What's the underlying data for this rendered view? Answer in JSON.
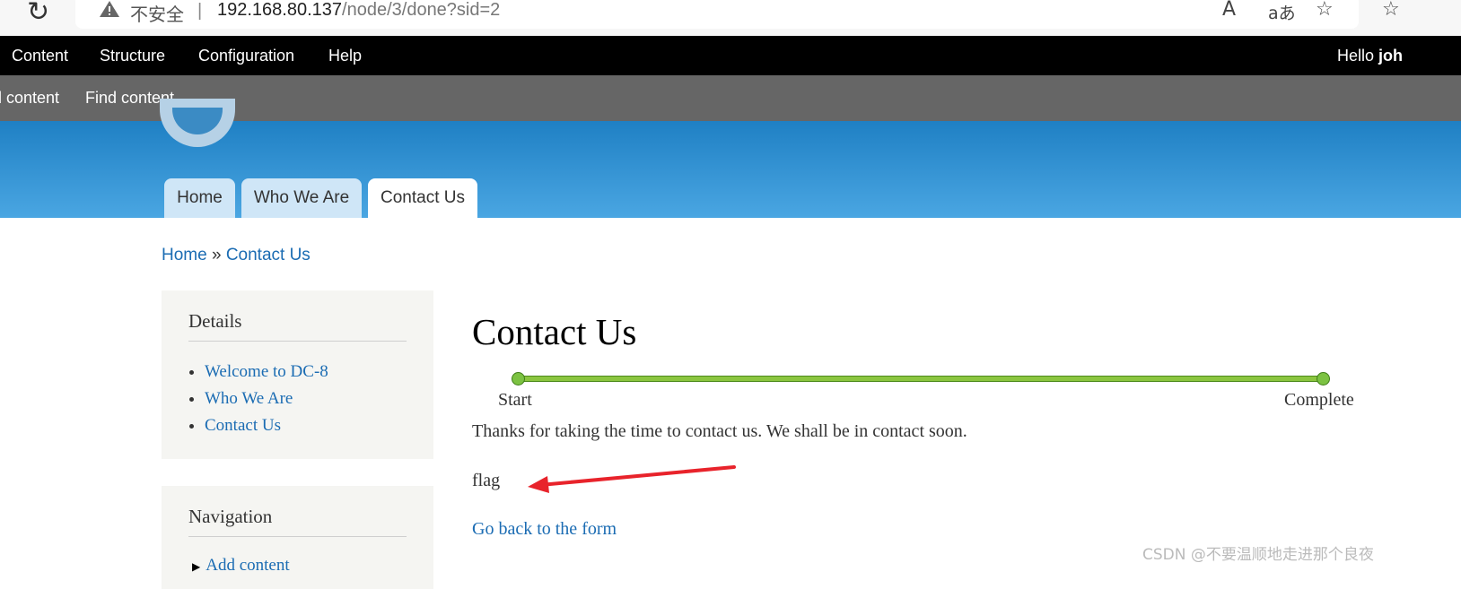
{
  "browser": {
    "insecure_label": "不安全",
    "url_host": "192.168.80.137",
    "url_path": "/node/3/done?sid=2",
    "reload_glyph": "↻",
    "read_aloud_glyph": "A",
    "translate_glyph": "aあ",
    "favorite_glyph": "☆",
    "favorites_glyph": "☆"
  },
  "toolbar": {
    "items": [
      "Content",
      "Structure",
      "Configuration",
      "Help"
    ],
    "hello_prefix": "Hello ",
    "user": "joh"
  },
  "shortcuts": {
    "items": [
      "l content",
      "Find content"
    ]
  },
  "tabs": [
    {
      "label": "Home",
      "active": false
    },
    {
      "label": "Who We Are",
      "active": false
    },
    {
      "label": "Contact Us",
      "active": true
    }
  ],
  "breadcrumb": {
    "items": [
      "Home",
      "Contact Us"
    ],
    "separator": "»"
  },
  "sidebar": {
    "details": {
      "title": "Details",
      "links": [
        "Welcome to DC-8",
        "Who We Are",
        "Contact Us"
      ]
    },
    "navigation": {
      "title": "Navigation",
      "links": [
        "Add content"
      ]
    }
  },
  "main": {
    "title": "Contact Us",
    "progress": {
      "start_label": "Start",
      "end_label": "Complete",
      "completed_fraction": 1.0
    },
    "confirmation": "Thanks for taking the time to contact us. We shall be in contact soon.",
    "flag_text": "flag",
    "back_link": "Go back to the form"
  },
  "annotation": {
    "arrow_color": "#e8232b"
  },
  "watermark": "CSDN @不要温顺地走进那个良夜",
  "colors": {
    "link": "#1b6cb3",
    "toolbar_bg": "#000000",
    "shortcuts_bg": "#666666",
    "header_top": "#1f80c4",
    "header_bottom": "#4aa6e2",
    "progress": "#8bc53f",
    "sidebar_bg": "#f5f5f2"
  }
}
